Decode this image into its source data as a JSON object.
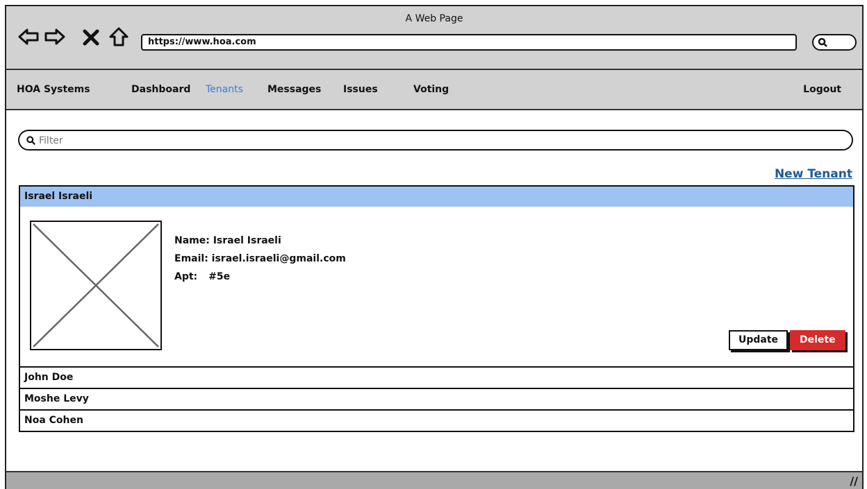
{
  "browser": {
    "window_title": "A Web Page",
    "url": "https://www.hoa.com"
  },
  "nav": {
    "brand": "HOA Systems",
    "items": [
      "Dashboard",
      "Tenants",
      "Messages",
      "Issues",
      "Voting"
    ],
    "active": "Tenants",
    "logout": "Logout",
    "active_color": "#3a7bd5"
  },
  "filter": {
    "placeholder": "Filter"
  },
  "actions": {
    "new_tenant": "New Tenant"
  },
  "tenants": [
    {
      "name": "Israel Israeli",
      "expanded": true
    },
    {
      "name": "John Doe",
      "expanded": false
    },
    {
      "name": "Moshe Levy",
      "expanded": false
    },
    {
      "name": "Noa Cohen",
      "expanded": false
    }
  ],
  "detail": {
    "name_line": "Name: Israel Israeli",
    "email_line": "Email: israel.israeli@gmail.com",
    "apt_label": "Apt:",
    "apt_value": "#5e",
    "update": "Update",
    "delete": "Delete"
  },
  "colors": {
    "selected_row": "#9ec2f2",
    "delete_button": "#d62b2b",
    "link": "#1e5b99"
  }
}
